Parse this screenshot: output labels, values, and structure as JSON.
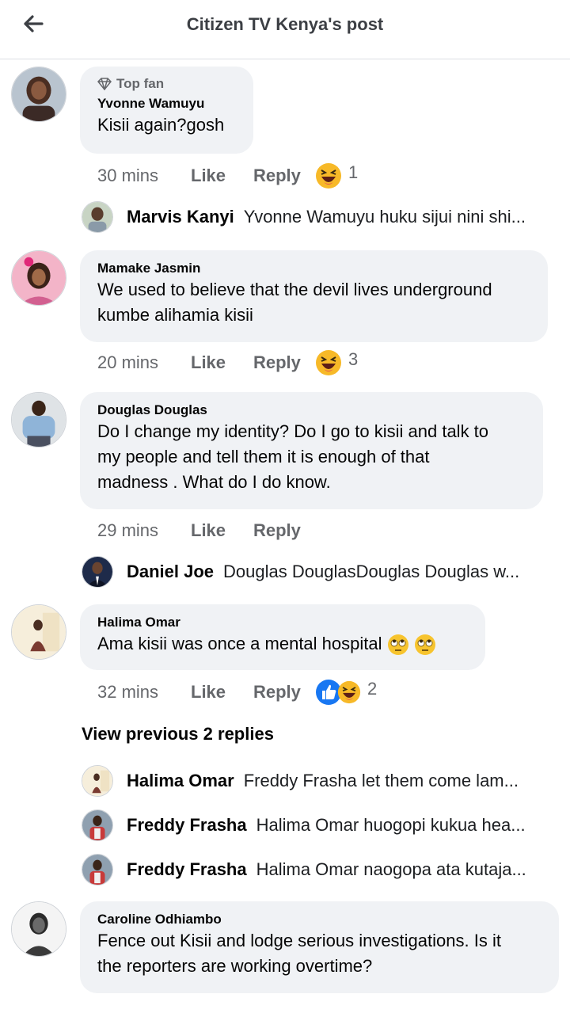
{
  "header": {
    "title": "Citizen TV Kenya's post"
  },
  "comments": [
    {
      "badge": "Top fan",
      "author": "Yvonne Wamuyu",
      "text": "Kisii again?gosh",
      "time": "30 mins",
      "like": "Like",
      "reply": "Reply",
      "reaction_count": "1"
    },
    {
      "author": "Mamake Jasmin",
      "text_lines": [
        "We used to believe that the devil lives underground",
        "kumbe alihamia kisii"
      ],
      "time": "20 mins",
      "like": "Like",
      "reply": "Reply",
      "reaction_count": "3"
    },
    {
      "author": "Douglas Douglas",
      "text_lines": [
        "Do I change my identity? Do I go to kisii and talk to",
        "my people and tell them it is enough of that",
        "madness . What do I do know."
      ],
      "time": "29 mins",
      "like": "Like",
      "reply": "Reply"
    },
    {
      "author": "Halima Omar",
      "text": "Ama kisii was once a mental hospital",
      "time": "32 mins",
      "like": "Like",
      "reply": "Reply",
      "reaction_count": "2"
    },
    {
      "author": "Caroline Odhiambo",
      "text_lines": [
        "Fence out Kisii and lodge serious investigations. Is it",
        "the reporters are working overtime?"
      ]
    }
  ],
  "replies": [
    {
      "name": "Marvis Kanyi",
      "text": "Yvonne Wamuyu huku sijui nini shi..."
    },
    {
      "name": "Daniel Joe",
      "text": "Douglas DouglasDouglas Douglas w..."
    },
    {
      "name": "Halima Omar",
      "text": "Freddy Frasha let them come lam..."
    },
    {
      "name": "Freddy Frasha",
      "text": "Halima Omar huogopi kukua hea..."
    },
    {
      "name": "Freddy Frasha",
      "text": "Halima Omar naogopa ata kutaja..."
    }
  ],
  "view_previous": "View previous 2 replies",
  "colors": {
    "bubble": "#f0f2f5",
    "muted": "#65676b",
    "like_blue": "#1877f2",
    "haha_yellow": "#f7b928"
  }
}
